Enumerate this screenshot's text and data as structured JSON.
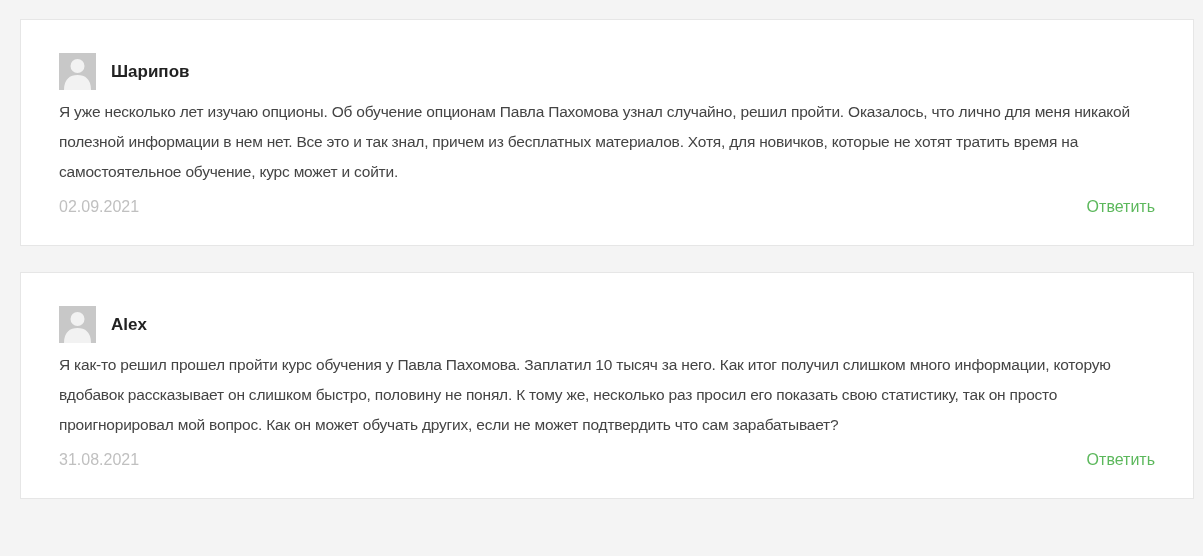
{
  "comments": [
    {
      "author": "Шарипов",
      "text": "Я уже несколько лет изучаю опционы. Об обучение опционам Павла Пахомова узнал случайно, решил пройти. Оказалось, что лично для меня никакой полезной информации в нем нет. Все это и так знал, причем из бесплатных материалов. Хотя, для новичков, которые не хотят тратить время на самостоятельное обучение, курс может и сойти.",
      "date": "02.09.2021",
      "reply": "Ответить"
    },
    {
      "author": "Alex",
      "text": "Я как-то решил прошел пройти курс обучения у Павла Пахомова. Заплатил 10 тысяч за него. Как итог получил слишком много информации, которую вдобавок рассказывает он слишком быстро, половину не понял. К тому же, несколько раз просил его показать свою статистику, так он просто проигнорировал мой вопрос. Как он может обучать других, если не может подтвердить что сам зарабатывает?",
      "date": "31.08.2021",
      "reply": "Ответить"
    }
  ]
}
